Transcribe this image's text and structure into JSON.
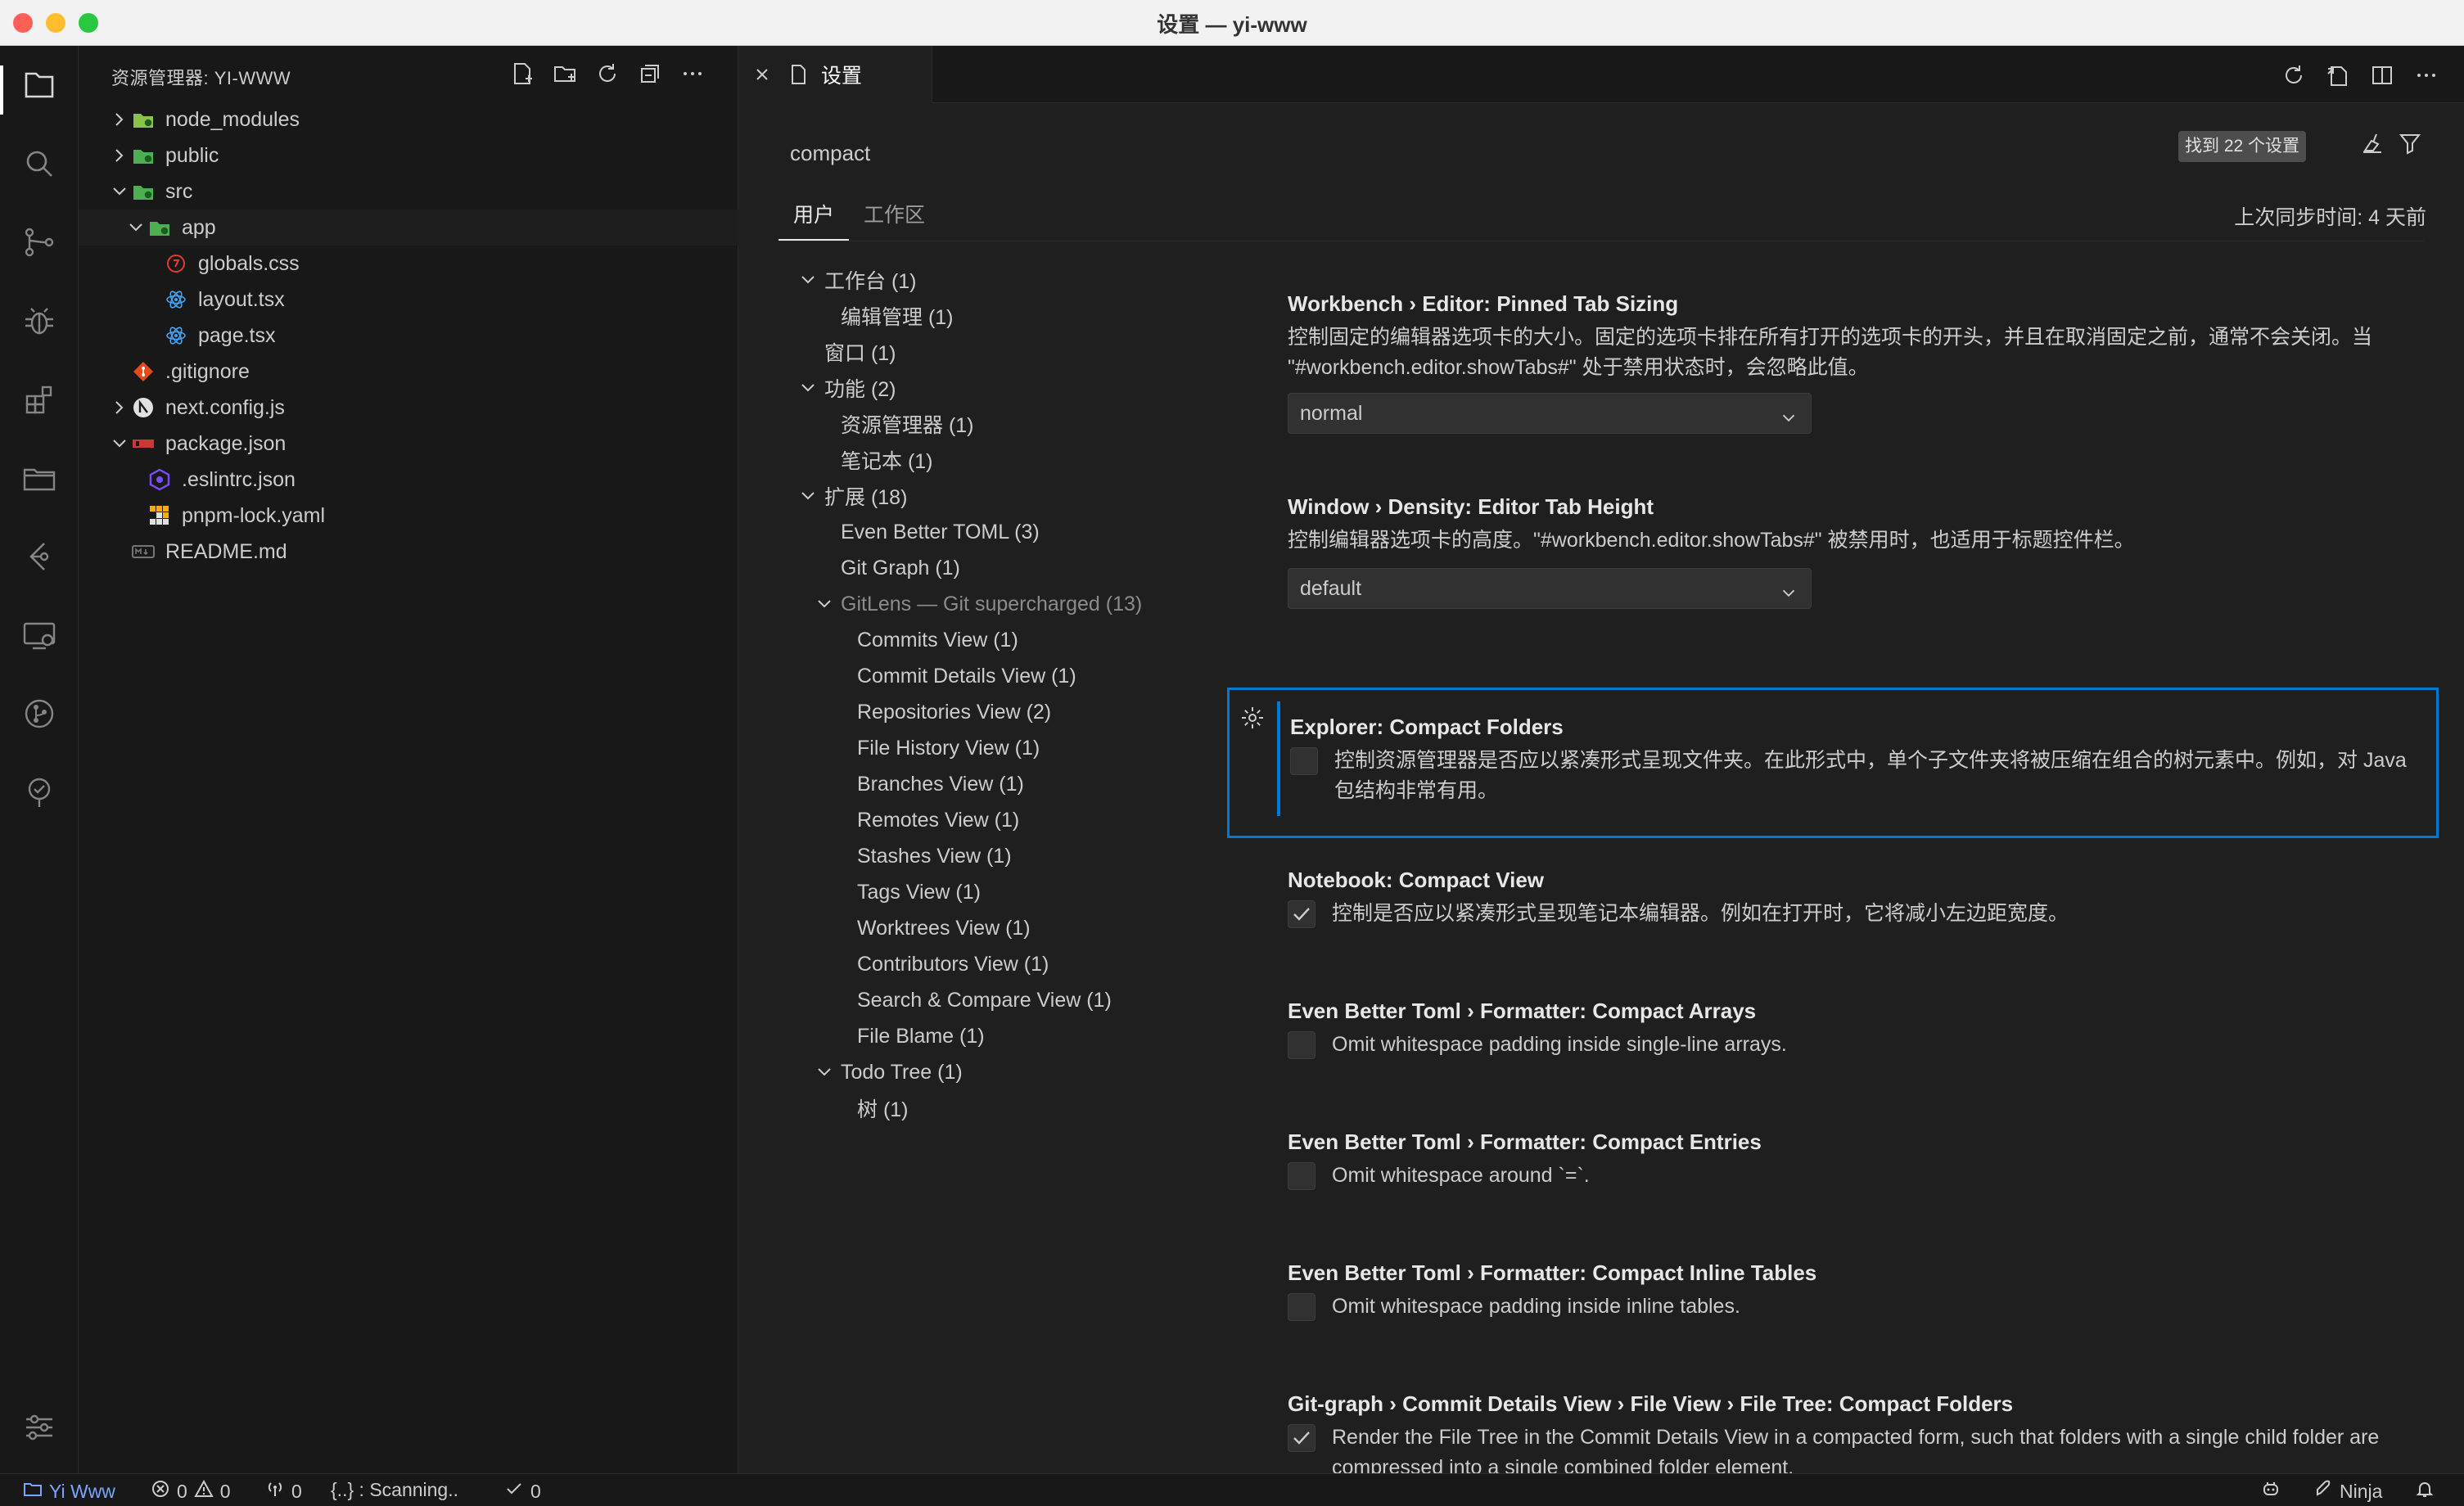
{
  "window": {
    "title": "设置 — yi-www"
  },
  "sidebar": {
    "title": "资源管理器: YI-WWW",
    "tree": [
      {
        "label": "node_modules",
        "depth": 0,
        "chevron": "right",
        "icon": "node-folder-icon",
        "color": "#8bc34a"
      },
      {
        "label": "public",
        "depth": 0,
        "chevron": "right",
        "icon": "public-folder-icon",
        "color": "#4caf50"
      },
      {
        "label": "src",
        "depth": 0,
        "chevron": "down",
        "icon": "src-folder-icon",
        "color": "#4caf50"
      },
      {
        "label": "app",
        "depth": 1,
        "chevron": "down",
        "icon": "app-folder-icon",
        "color": "#4caf50"
      },
      {
        "label": "globals.css",
        "depth": 2,
        "chevron": "",
        "icon": "css-file-icon",
        "color": "#e53935"
      },
      {
        "label": "layout.tsx",
        "depth": 2,
        "chevron": "",
        "icon": "react-file-icon",
        "color": "#42a5f5"
      },
      {
        "label": "page.tsx",
        "depth": 2,
        "chevron": "",
        "icon": "react-file-icon",
        "color": "#42a5f5"
      },
      {
        "label": ".gitignore",
        "depth": 0,
        "chevron": "",
        "icon": "git-file-icon",
        "color": "#e64a19"
      },
      {
        "label": "next.config.js",
        "depth": 0,
        "chevron": "right",
        "icon": "next-file-icon",
        "color": "#ffffff"
      },
      {
        "label": "package.json",
        "depth": 0,
        "chevron": "down",
        "icon": "npm-file-icon",
        "color": "#cb3837"
      },
      {
        "label": ".eslintrc.json",
        "depth": 1,
        "chevron": "",
        "icon": "eslint-file-icon",
        "color": "#7c4dff"
      },
      {
        "label": "pnpm-lock.yaml",
        "depth": 1,
        "chevron": "",
        "icon": "pnpm-file-icon",
        "color": "#f9ad00"
      },
      {
        "label": "README.md",
        "depth": 0,
        "chevron": "",
        "icon": "markdown-file-icon",
        "color": "#757575"
      }
    ]
  },
  "editor": {
    "tab_label": "设置",
    "search_value": "compact",
    "search_count": "找到 22 个设置",
    "scope_tabs": [
      "用户",
      "工作区"
    ],
    "sync_status": "上次同步时间: 4 天前",
    "toc": [
      {
        "label": "工作台 (1)",
        "depth": 0,
        "chevron": "down",
        "dim": false
      },
      {
        "label": "编辑管理 (1)",
        "depth": 1,
        "chevron": "",
        "dim": false
      },
      {
        "label": "窗口 (1)",
        "depth": 0,
        "chevron": "",
        "dim": false
      },
      {
        "label": "功能 (2)",
        "depth": 0,
        "chevron": "down",
        "dim": false
      },
      {
        "label": "资源管理器 (1)",
        "depth": 1,
        "chevron": "",
        "dim": false
      },
      {
        "label": "笔记本 (1)",
        "depth": 1,
        "chevron": "",
        "dim": false
      },
      {
        "label": "扩展 (18)",
        "depth": 0,
        "chevron": "down",
        "dim": false
      },
      {
        "label": "Even Better TOML (3)",
        "depth": 1,
        "chevron": "",
        "dim": false
      },
      {
        "label": "Git Graph (1)",
        "depth": 1,
        "chevron": "",
        "dim": false
      },
      {
        "label": "GitLens — Git supercharged (13)",
        "depth": 1,
        "chevron": "down",
        "dim": true
      },
      {
        "label": "Commits View (1)",
        "depth": 2,
        "chevron": "",
        "dim": false
      },
      {
        "label": "Commit Details View (1)",
        "depth": 2,
        "chevron": "",
        "dim": false
      },
      {
        "label": "Repositories View (2)",
        "depth": 2,
        "chevron": "",
        "dim": false
      },
      {
        "label": "File History View (1)",
        "depth": 2,
        "chevron": "",
        "dim": false
      },
      {
        "label": "Branches View (1)",
        "depth": 2,
        "chevron": "",
        "dim": false
      },
      {
        "label": "Remotes View (1)",
        "depth": 2,
        "chevron": "",
        "dim": false
      },
      {
        "label": "Stashes View (1)",
        "depth": 2,
        "chevron": "",
        "dim": false
      },
      {
        "label": "Tags View (1)",
        "depth": 2,
        "chevron": "",
        "dim": false
      },
      {
        "label": "Worktrees View (1)",
        "depth": 2,
        "chevron": "",
        "dim": false
      },
      {
        "label": "Contributors View (1)",
        "depth": 2,
        "chevron": "",
        "dim": false
      },
      {
        "label": "Search & Compare View (1)",
        "depth": 2,
        "chevron": "",
        "dim": false
      },
      {
        "label": "File Blame (1)",
        "depth": 2,
        "chevron": "",
        "dim": false
      },
      {
        "label": "Todo Tree (1)",
        "depth": 1,
        "chevron": "down",
        "dim": false
      },
      {
        "label": "树 (1)",
        "depth": 2,
        "chevron": "",
        "dim": false
      }
    ],
    "settings": [
      {
        "title": "Workbench › Editor: Pinned Tab Sizing",
        "desc": "控制固定的编辑器选项卡的大小。固定的选项卡排在所有打开的选项卡的开头，并且在取消固定之前，通常不会关闭。当 \"#workbench.editor.showTabs#\" 处于禁用状态时，会忽略此值。",
        "select": "normal"
      },
      {
        "title": "Window › Density: Editor Tab Height",
        "desc": "控制编辑器选项卡的高度。\"#workbench.editor.showTabs#\" 被禁用时，也适用于标题控件栏。",
        "select": "default"
      },
      {
        "title": "Explorer: Compact Folders",
        "desc": "控制资源管理器是否应以紧凑形式呈现文件夹。在此形式中，单个子文件夹将被压缩在组合的树元素中。例如，对 Java 包结构非常有用。",
        "checked": false
      },
      {
        "title": "Notebook: Compact View",
        "desc": "控制是否应以紧凑形式呈现笔记本编辑器。例如在打开时，它将减小左边距宽度。",
        "checked": true
      },
      {
        "title": "Even Better Toml › Formatter: Compact Arrays",
        "desc": "Omit whitespace padding inside single-line arrays.",
        "checked": false
      },
      {
        "title": "Even Better Toml › Formatter: Compact Entries",
        "desc": "Omit whitespace around `=`.",
        "checked": false
      },
      {
        "title": "Even Better Toml › Formatter: Compact Inline Tables",
        "desc": "Omit whitespace padding inside inline tables.",
        "checked": false
      },
      {
        "title": "Git-graph › Commit Details View › File View › File Tree: Compact Folders",
        "desc": "Render the File Tree in the Commit Details View in a compacted form, such that folders with a single child folder are compressed into a single combined folder element.",
        "checked": true
      }
    ]
  },
  "statusbar": {
    "remote": "Yi Www",
    "errors": "0",
    "warnings": "0",
    "ports": "0",
    "scanning": "{..} : Scanning..",
    "checks": "0",
    "ninja": "Ninja"
  },
  "colors": {
    "accent": "#0078d4",
    "remote": "#7aa6ff"
  }
}
